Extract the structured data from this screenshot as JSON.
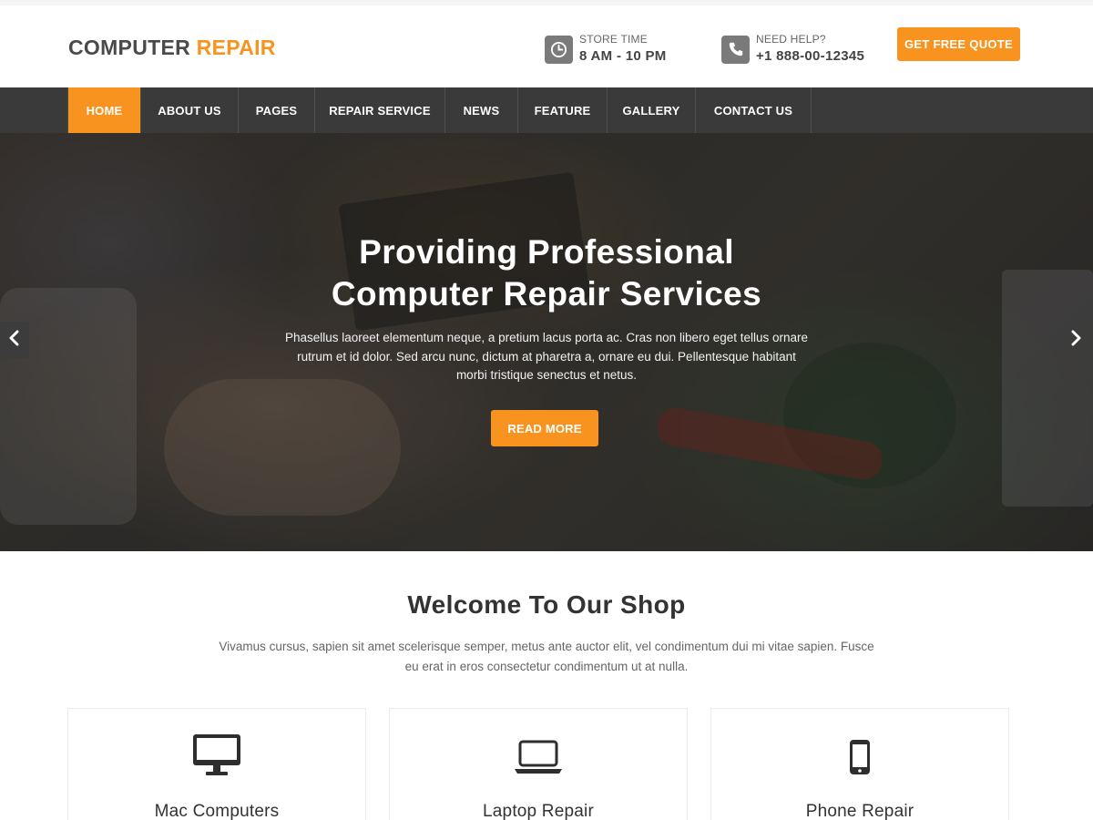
{
  "header": {
    "logo_main": "COMPUTER",
    "logo_accent": "REPAIR",
    "store_time": {
      "label": "STORE TIME",
      "value": "8 AM - 10 PM",
      "icon": "clock-icon"
    },
    "help": {
      "label": "NEED HELP?",
      "value": "+1 888-00-12345",
      "icon": "phone-icon"
    },
    "quote_button": "GET FREE QUOTE"
  },
  "nav": {
    "items": [
      {
        "label": "HOME",
        "active": true
      },
      {
        "label": "ABOUT US"
      },
      {
        "label": "PAGES"
      },
      {
        "label": "REPAIR SERVICE"
      },
      {
        "label": "NEWS"
      },
      {
        "label": "FEATURE"
      },
      {
        "label": "GALLERY"
      },
      {
        "label": "CONTACT US"
      }
    ]
  },
  "hero": {
    "title_line1": "Providing Professional",
    "title_line2": "Computer Repair Services",
    "text_line1": "Phasellus laoreet elementum neque, a pretium lacus porta ac. Cras non libero eget tellus ornare",
    "text_line2": "rutrum et id dolor. Sed arcu nunc, dictum at pharetra a, ornare eu dui. Pellentesque habitant",
    "text_line3": "morbi tristique senectus et netus.",
    "button": "READ MORE",
    "prev_icon": "chevron-left-icon",
    "next_icon": "chevron-right-icon"
  },
  "welcome": {
    "title": "Welcome To Our Shop",
    "text_line1": "Vivamus cursus, sapien sit amet scelerisque semper, metus ante auctor elit, vel condimentum dui mi vitae sapien. Fusce",
    "text_line2": "eu erat in eros consectetur condimentum ut at nulla."
  },
  "services": [
    {
      "title": "Mac Computers",
      "icon": "monitor-icon"
    },
    {
      "title": "Laptop Repair",
      "icon": "laptop-icon"
    },
    {
      "title": "Phone Repair",
      "icon": "phone-mobile-icon"
    }
  ],
  "colors": {
    "accent": "#f7931e",
    "nav_bg": "#3a3a3a",
    "text": "#333333"
  }
}
